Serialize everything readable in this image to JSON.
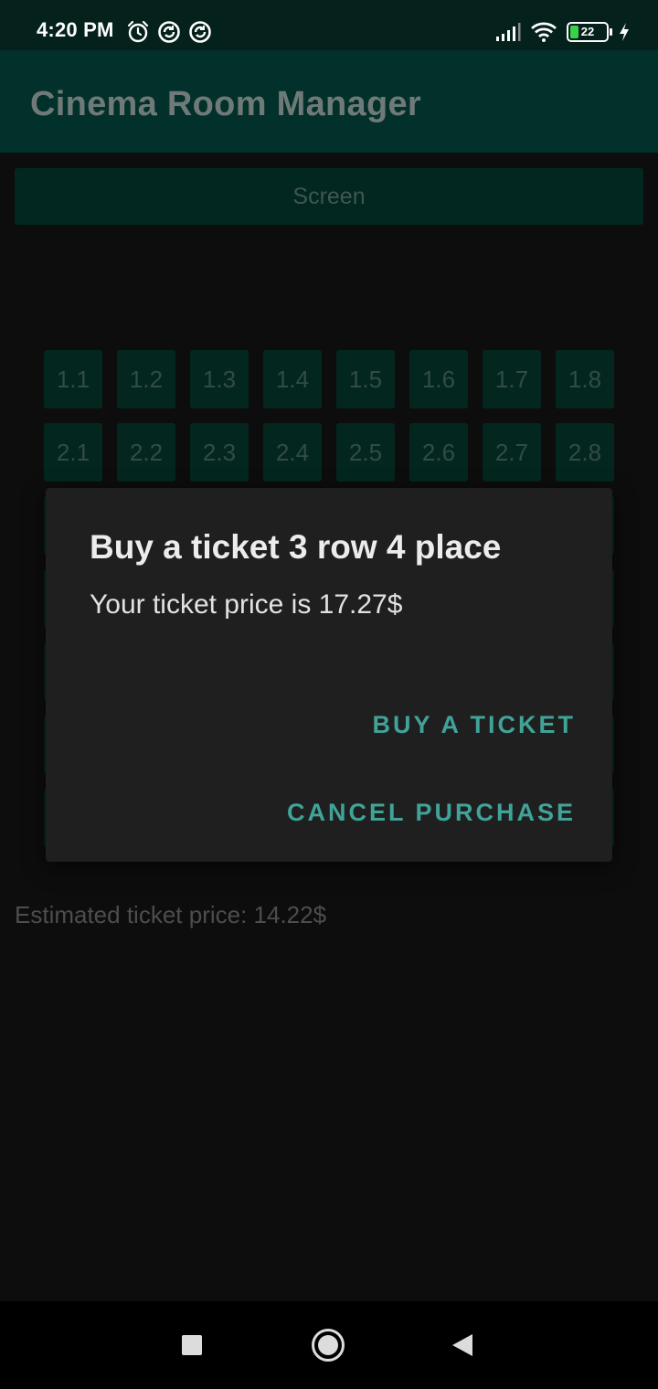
{
  "status_bar": {
    "time": "4:20 PM",
    "battery_level": "22",
    "left_icons": [
      "alarm-icon",
      "sync-icon",
      "sync-icon"
    ],
    "right_icons": [
      "signal-icon",
      "wifi-icon",
      "battery-icon",
      "charging-icon"
    ]
  },
  "app_bar": {
    "title": "Cinema Room Manager"
  },
  "screen_label": "Screen",
  "seats": {
    "row1": [
      "1.1",
      "1.2",
      "1.3",
      "1.4",
      "1.5",
      "1.6",
      "1.7",
      "1.8"
    ],
    "row2": [
      "2.1",
      "2.2",
      "2.3",
      "2.4",
      "2.5",
      "2.6",
      "2.7",
      "2.8"
    ]
  },
  "estimated_price": "Estimated ticket price: 14.22$",
  "dialog": {
    "title": "Buy a ticket 3 row 4 place",
    "message": "Your ticket price is 17.27$",
    "buy_label": "BUY A TICKET",
    "cancel_label": "CANCEL PURCHASE"
  },
  "nav_bar": {
    "icons": [
      "recents-icon",
      "home-icon",
      "back-icon"
    ]
  },
  "colors": {
    "accent": "#40a398",
    "app_bar": "#02302a",
    "seat": "#03271f",
    "background": "#0d0d0d"
  }
}
